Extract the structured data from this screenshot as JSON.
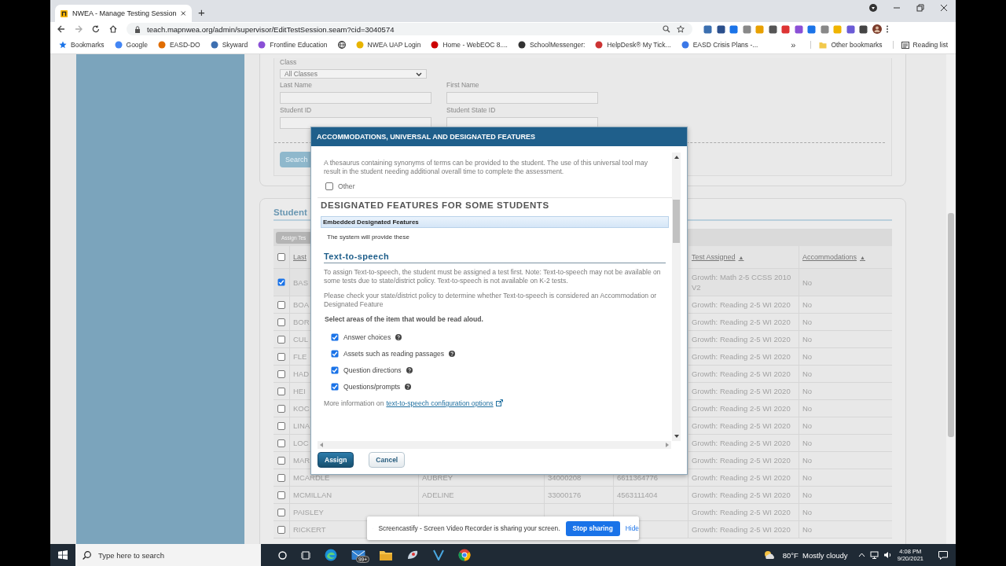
{
  "browser": {
    "tab_title": "NWEA - Manage Testing Session",
    "new_tab": "+",
    "url": "teach.mapnwea.org/admin/supervisor/EditTestSession.seam?cid=3040574",
    "bookmarks": [
      {
        "kind": "link",
        "label": "Bookmarks"
      },
      {
        "kind": "link",
        "label": "Google"
      },
      {
        "kind": "link",
        "label": "EASD-DO"
      },
      {
        "kind": "link",
        "label": "Skyward"
      },
      {
        "kind": "link",
        "label": "Frontline Education"
      },
      {
        "kind": "icon"
      },
      {
        "kind": "link",
        "label": "NWEA UAP Login"
      },
      {
        "kind": "link",
        "label": "Home - WebEOC 8...."
      },
      {
        "kind": "link",
        "label": "SchoolMessenger:"
      },
      {
        "kind": "link",
        "label": "HelpDesk® My Tick..."
      },
      {
        "kind": "link",
        "label": "EASD Crisis Plans -..."
      }
    ],
    "more_bookmarks": "»",
    "other_bookmarks": "Other bookmarks",
    "reading_list": "Reading list"
  },
  "search_form": {
    "fields": [
      {
        "kind": "select",
        "label": "Class",
        "value": "All Classes"
      },
      {
        "kind": "text",
        "label": "Last Name"
      },
      {
        "kind": "text",
        "label": "First Name"
      },
      {
        "kind": "text",
        "label": "Student ID"
      },
      {
        "kind": "text",
        "label": "Student State ID"
      }
    ],
    "search_button": "Search"
  },
  "students": {
    "title": "Student",
    "assign_button": "Assign Tes",
    "header_checked": false,
    "columns": [
      {
        "label": "Last"
      },
      {
        "label": "Test Assigned",
        "sort_arrow": "▲"
      },
      {
        "label": "Accommodations",
        "sort_arrow": "▲"
      }
    ],
    "rows": [
      {
        "checked": true,
        "last_name": "BAS",
        "test": "Growth: Math 2-5 CCSS 2010 V2",
        "accommodations": "No"
      },
      {
        "checked": false,
        "last_name": "BOA",
        "test": "Growth: Reading 2-5 WI 2020",
        "accommodations": "No"
      },
      {
        "checked": false,
        "last_name": "BOR",
        "test": "Growth: Reading 2-5 WI 2020",
        "accommodations": "No"
      },
      {
        "checked": false,
        "last_name": "CUL",
        "test": "Growth: Reading 2-5 WI 2020",
        "accommodations": "No"
      },
      {
        "checked": false,
        "last_name": "FLE",
        "test": "Growth: Reading 2-5 WI 2020",
        "accommodations": "No"
      },
      {
        "checked": false,
        "last_name": "HAD",
        "test": "Growth: Reading 2-5 WI 2020",
        "accommodations": "No"
      },
      {
        "checked": false,
        "last_name": "HEI",
        "test": "Growth: Reading 2-5 WI 2020",
        "accommodations": "No"
      },
      {
        "checked": false,
        "last_name": "KOC",
        "test": "Growth: Reading 2-5 WI 2020",
        "accommodations": "No"
      },
      {
        "checked": false,
        "last_name": "LINA",
        "test": "Growth: Reading 2-5 WI 2020",
        "accommodations": "No"
      },
      {
        "checked": false,
        "last_name": "LOC",
        "test": "Growth: Reading 2-5 WI 2020",
        "accommodations": "No"
      },
      {
        "checked": false,
        "last_name": "MAR",
        "test": "Growth: Reading 2-5 WI 2020",
        "accommodations": "No"
      },
      {
        "checked": false,
        "last_name": "MCARDLE",
        "first_name": "AUBREY",
        "student_id": "34000208",
        "state_id": "6611364776",
        "test": "Growth: Reading 2-5 WI 2020",
        "accommodations": "No"
      },
      {
        "checked": false,
        "last_name": "MCMILLAN",
        "first_name": "ADELINE",
        "student_id": "33000176",
        "state_id": "4563111404",
        "test": "Growth: Reading 2-5 WI 2020",
        "accommodations": "No"
      },
      {
        "checked": false,
        "last_name": "PAISLEY",
        "test": "Growth: Reading 2-5 WI 2020",
        "accommodations": "No"
      },
      {
        "checked": false,
        "last_name": "RICKERT",
        "test": "Growth: Reading 2-5 WI 2020",
        "accommodations": "No"
      }
    ]
  },
  "modal": {
    "title": "ACCOMMODATIONS, UNIVERSAL AND DESIGNATED FEATURES",
    "thesaurus_text": "A thesaurus containing synonyms of terms can be provided to the student. The use of this universal tool may result in the student needing additional overall time to complete the assessment.",
    "other": {
      "label": "Other",
      "checked": false
    },
    "section_heading": "DESIGNATED FEATURES FOR SOME STUDENTS",
    "group_title": "Embedded Designated Features",
    "group_note": "The system will provide these",
    "feature_title": "Text-to-speech",
    "paragraphs": [
      "To assign Text-to-speech, the student must be assigned a test first. Note: Text-to-speech may not be available on some tests due to state/district policy. Text-to-speech is not available on K-2 tests.",
      "Please check your state/district policy to determine whether Text-to-speech is considered an Accommodation or Designated Feature"
    ],
    "select_prompt": "Select areas of the item that would be read aloud.",
    "options": [
      {
        "label": "Answer choices",
        "checked": true
      },
      {
        "label": "Assets such as reading passages",
        "checked": true
      },
      {
        "label": "Question directions",
        "checked": true
      },
      {
        "label": "Questions/prompts",
        "checked": true
      }
    ],
    "more_info": "More information on",
    "more_info_link": "text-to-speech configuration options",
    "buttons": [
      {
        "kind": "primary",
        "label": "Assign"
      },
      {
        "kind": "secondary",
        "label": "Cancel"
      }
    ]
  },
  "share_bar": {
    "message": "Screencastify - Screen Video Recorder is sharing your screen.",
    "stop_button": "Stop sharing",
    "hide_link": "Hide"
  },
  "taskbar": {
    "search_placeholder": "Type here to search",
    "mail_badge": "99+",
    "weather": "80°F  Mostly cloudy",
    "time": "4:08 PM",
    "date": "9/20/2021"
  }
}
